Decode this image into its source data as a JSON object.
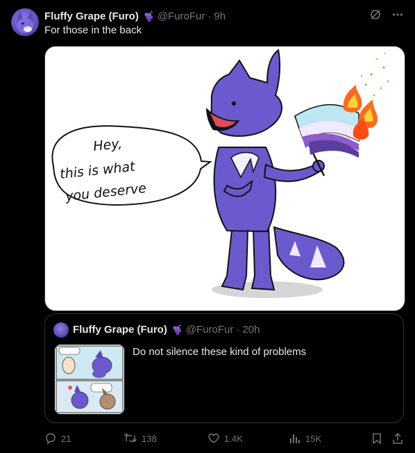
{
  "tweet": {
    "author_name": "Fluffy Grape (Furo)",
    "handle": "@FuroFur",
    "separator": "·",
    "time": "9h",
    "text": "For those in the back",
    "image_text": {
      "line1": "Hey,",
      "line2": "this is what",
      "line3": "you deserve"
    }
  },
  "quote": {
    "author_name": "Fluffy Grape (Furo)",
    "handle": "@FuroFur",
    "separator": "·",
    "time": "20h",
    "text": "Do not silence these kind of problems"
  },
  "actions": {
    "replies": "21",
    "reposts": "138",
    "likes": "1.4K",
    "views": "15K"
  },
  "icons": {
    "grape": "grape-emoji-icon",
    "grok": "grok-icon",
    "more": "more-icon",
    "reply": "reply-icon",
    "repost": "repost-icon",
    "like": "heart-icon",
    "views": "views-icon",
    "bookmark": "bookmark-icon",
    "share": "share-icon"
  },
  "colors": {
    "background": "#000000",
    "text": "#e7e9ea",
    "muted": "#71767b",
    "border": "#2f3336",
    "character": "#6a5acd"
  }
}
